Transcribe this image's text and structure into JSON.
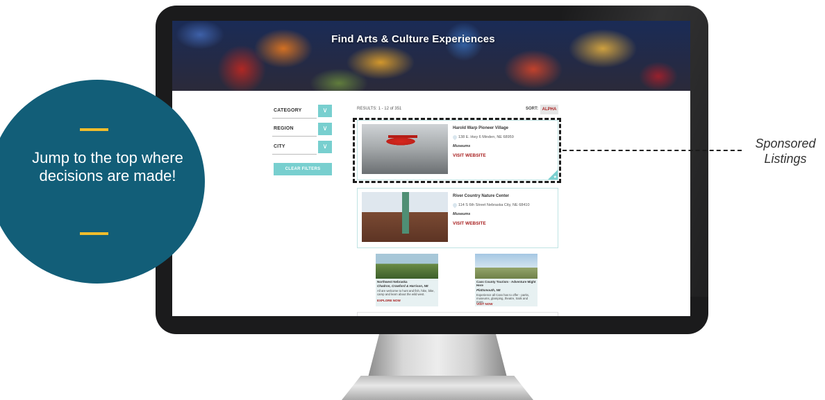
{
  "hero": {
    "title": "Find Arts & Culture Experiences"
  },
  "filters": {
    "items": [
      {
        "label": "CATEGORY"
      },
      {
        "label": "REGION"
      },
      {
        "label": "CITY"
      }
    ],
    "clear_label": "CLEAR FILTERS",
    "toggle_icon": "chevron-down-icon"
  },
  "results": {
    "count_text": "RESULTS: 1 - 12 of 351",
    "sort_label": "SORT:",
    "sort_value": "ALPHA"
  },
  "listings": [
    {
      "title": "Harold Warp Pioneer Village",
      "address": "138 E. Hwy 6 Minden, NE 68959",
      "category": "Museums",
      "link": "VISIT WEBSITE"
    },
    {
      "title": "River Country Nature Center",
      "address": "114 S 6th Street Nebraska City, NE 68410",
      "category": "Museums",
      "link": "VISIT WEBSITE"
    }
  ],
  "cards": [
    {
      "title": "Northwest Nebraska",
      "subtitle": "Chadron, Crawford & Harrison, NE",
      "description": "All are welcome to hunt and fish, hike, bike, camp and learn about the wild west.",
      "link": "EXPLORE NOW"
    },
    {
      "title": "Cass County Tourism - Adventure Might Here",
      "subtitle": "Plattsmouth, NE",
      "description": "Experience all Cass has to offer - parks, museums, glamping, theatre, trails and more.",
      "link": "VISIT NOW"
    }
  ],
  "callout": {
    "circle_text": "Jump to the top where decisions are made!",
    "sponsored_label": "Sponsored Listings"
  },
  "colors": {
    "accent_teal": "#78cfcf",
    "circle_blue": "#125e78",
    "gold_bar": "#f0bd2c",
    "link_red": "#a71d1d"
  }
}
